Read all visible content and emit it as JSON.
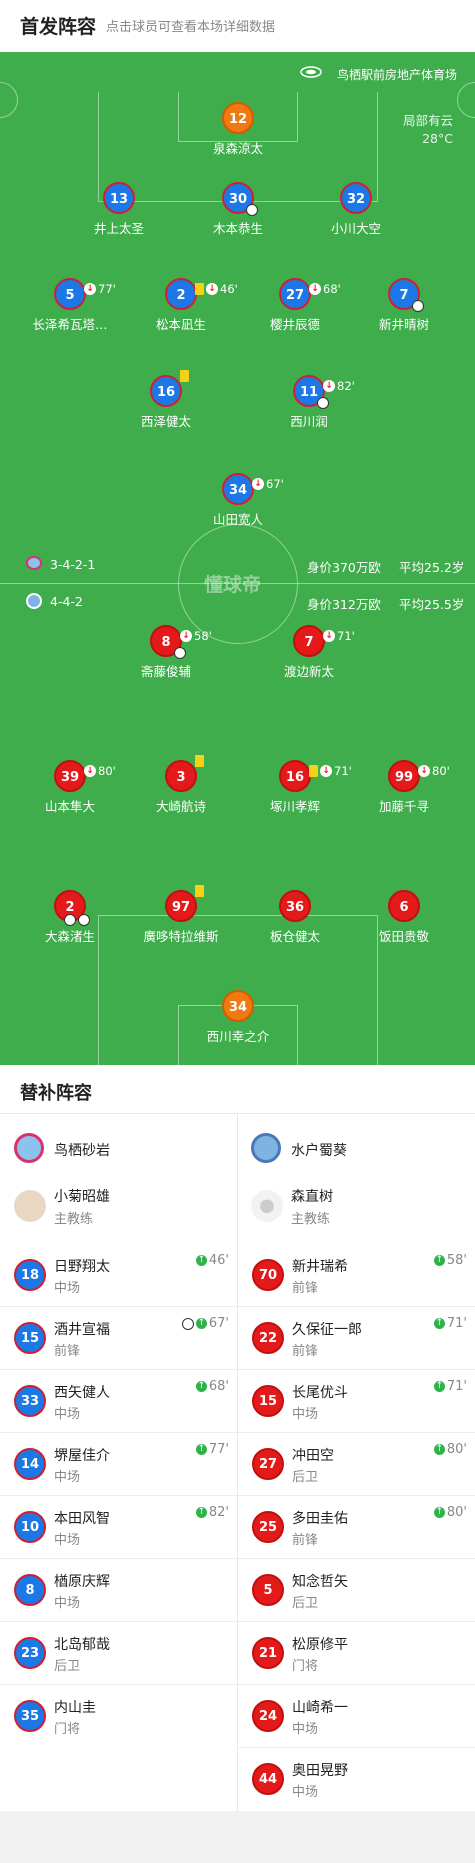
{
  "header": {
    "title": "首发阵容",
    "subtitle": "点击球员可查看本场详细数据"
  },
  "venue": "鸟栖駅前房地产体育场",
  "weather": {
    "condition": "局部有云",
    "temp": "28°C"
  },
  "watermark": "懂球帝",
  "home_formation": "3-4-2-1",
  "home_value": "身价370万欧",
  "home_age": "平均25.2岁",
  "away_formation": "4-4-2",
  "away_value": "身价312万欧",
  "away_age": "平均25.5岁",
  "home_players": [
    {
      "num": "12",
      "name": "泉森涼太"
    },
    {
      "num": "13",
      "name": "井上太圣"
    },
    {
      "num": "30",
      "name": "木本恭生"
    },
    {
      "num": "32",
      "name": "小川大空"
    },
    {
      "num": "5",
      "name": "长泽希瓦塔…",
      "min": "77'"
    },
    {
      "num": "2",
      "name": "松本凪生",
      "min": "46'"
    },
    {
      "num": "27",
      "name": "樱井辰德",
      "min": "68'"
    },
    {
      "num": "7",
      "name": "新井晴树"
    },
    {
      "num": "16",
      "name": "西泽健太"
    },
    {
      "num": "11",
      "name": "西川润",
      "min": "82'"
    },
    {
      "num": "34",
      "name": "山田宽人",
      "min": "67'"
    }
  ],
  "away_players": [
    {
      "num": "8",
      "name": "斋藤俊辅",
      "min": "58'"
    },
    {
      "num": "7",
      "name": "渡边新太",
      "min": "71'"
    },
    {
      "num": "39",
      "name": "山本隼大",
      "min": "80'"
    },
    {
      "num": "3",
      "name": "大崎航诗"
    },
    {
      "num": "16",
      "name": "塚川孝辉",
      "min": "71'"
    },
    {
      "num": "99",
      "name": "加藤千寻",
      "min": "80'"
    },
    {
      "num": "2",
      "name": "大森渚生"
    },
    {
      "num": "97",
      "name": "廣哆特拉维斯"
    },
    {
      "num": "36",
      "name": "板仓健太"
    },
    {
      "num": "6",
      "name": "饭田贵敬"
    },
    {
      "num": "34",
      "name": "西川幸之介"
    }
  ],
  "subs": {
    "title": "替补阵容",
    "home": {
      "team": "鸟栖砂岩",
      "coach": "小菊昭雄",
      "coach_role": "主教练",
      "players": [
        {
          "num": "18",
          "name": "日野翔太",
          "pos": "中场",
          "min": "46'"
        },
        {
          "num": "15",
          "name": "酒井宣福",
          "pos": "前锋",
          "min": "67'"
        },
        {
          "num": "33",
          "name": "西矢健人",
          "pos": "中场",
          "min": "68'"
        },
        {
          "num": "14",
          "name": "堺屋佳介",
          "pos": "中场",
          "min": "77'"
        },
        {
          "num": "10",
          "name": "本田风智",
          "pos": "中场",
          "min": "82'"
        },
        {
          "num": "8",
          "name": "楢原庆辉",
          "pos": "中场"
        },
        {
          "num": "23",
          "name": "北岛郁哉",
          "pos": "后卫"
        },
        {
          "num": "35",
          "name": "内山圭",
          "pos": "门将"
        }
      ]
    },
    "away": {
      "team": "水户蜀葵",
      "coach": "森直树",
      "coach_role": "主教练",
      "players": [
        {
          "num": "70",
          "name": "新井瑞希",
          "pos": "前锋",
          "min": "58'"
        },
        {
          "num": "22",
          "name": "久保征一郎",
          "pos": "前锋",
          "min": "71'"
        },
        {
          "num": "15",
          "name": "长尾优斗",
          "pos": "中场",
          "min": "71'"
        },
        {
          "num": "27",
          "name": "冲田空",
          "pos": "后卫",
          "min": "80'"
        },
        {
          "num": "25",
          "name": "多田圭佑",
          "pos": "前锋",
          "min": "80'"
        },
        {
          "num": "5",
          "name": "知念哲矢",
          "pos": "后卫"
        },
        {
          "num": "21",
          "name": "松原修平",
          "pos": "门将"
        },
        {
          "num": "24",
          "name": "山崎希一",
          "pos": "中场"
        },
        {
          "num": "44",
          "name": "奥田晃野",
          "pos": "中场"
        }
      ]
    }
  }
}
